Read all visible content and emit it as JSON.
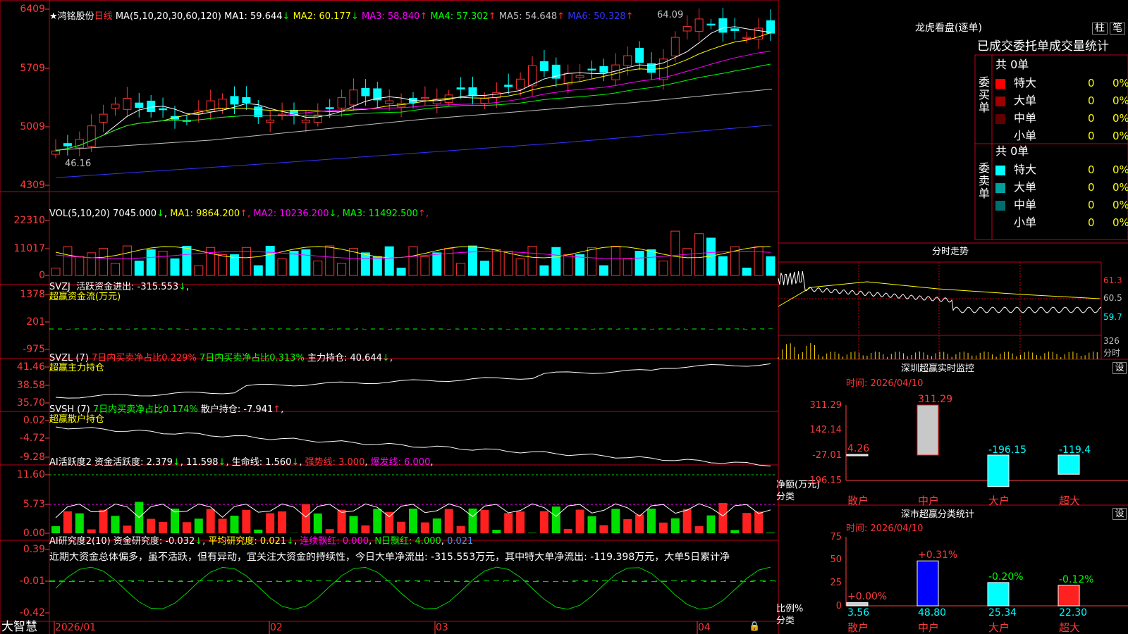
{
  "stock": {
    "name": "鸿铭股份",
    "period": "日线",
    "ma_label": "MA(5,10,20,30,60,120)",
    "ma": [
      {
        "label": "MA1: 59.644",
        "arrow": "↓",
        "color": "#ffffff"
      },
      {
        "label": "MA2: 60.177",
        "arrow": "↓",
        "color": "#ffff00"
      },
      {
        "label": "MA3: 58.840",
        "arrow": "↑",
        "color": "#ff00ff"
      },
      {
        "label": "MA4: 57.302",
        "arrow": "↑",
        "color": "#00ff00"
      },
      {
        "label": "MA5: 54.648",
        "arrow": "↑",
        "color": "#c0c0c0"
      },
      {
        "label": "MA6: 50.328",
        "arrow": "↑",
        "color": "#3333ff"
      }
    ],
    "high_label": "64.09",
    "low_label": "46.16"
  },
  "colors": {
    "up": "#ff3232",
    "down": "#00ffff",
    "grid": "#c0001a",
    "axis": "#ff3c3c"
  },
  "axes": {
    "price": [
      "6409",
      "5709",
      "5009",
      "4309"
    ],
    "vol": [
      "22310",
      "11017",
      "0"
    ],
    "svzj": [
      "1378",
      "201",
      "-975"
    ],
    "svzl": [
      "41.46",
      "38.58",
      "35.70"
    ],
    "svsh": [
      "0.02",
      "-4.72",
      "-9.28"
    ],
    "ai1": [
      "11.60",
      "5.73",
      "0.00"
    ],
    "ai2": [
      "0.39",
      "-0.01",
      "-0.42"
    ]
  },
  "vol": {
    "title": "VOL(5,10,20)",
    "v": "7045.000",
    "ma": [
      {
        "label": "MA1: 9864.200",
        "arrow": "↑",
        "color": "#ffff00"
      },
      {
        "label": "MA2: 10236.200",
        "arrow": "↓",
        "color": "#ff00ff"
      },
      {
        "label": "MA3: 11492.500",
        "arrow": "↑",
        "color": "#00ff00"
      }
    ]
  },
  "svzj": {
    "title": "SVZJ",
    "label": "活跃资金进出: -315.553",
    "arrow": "↓",
    "sub": "超赢资金流(万元)"
  },
  "svzl": {
    "title": "SVZL (7)",
    "a": "7日内买卖净占比0.229%",
    "b": "7日内买卖净占比0.313%",
    "c": "主力持仓: 40.644",
    "sub": "超赢主力持仓"
  },
  "svsh": {
    "title": "SVSH (7)",
    "a": "7日内买卖净占比0.174%",
    "c": "散户持仓: -7.941",
    "sub": "超赢散户持仓"
  },
  "ai1": {
    "title": "AI活跃度2",
    "a": "资金活跃度: 2.379",
    "b": "11.598",
    "c": "生命线: 1.560",
    "d": "强势线: 3.000",
    "e": "爆发线: 6.000"
  },
  "ai2": {
    "title": "AI研究度2(10)",
    "a": "资金研究度: -0.032",
    "b": "平均研究度: 0.021",
    "c": "连续飘红: 0.000",
    "d": "N日飘红: 4.000",
    "e": "0.021"
  },
  "commentary": "近期大资金总体偏多，虽不活跃，但有异动，宜关注大资金的持续性，今日大单净流出: -315.553万元，其中特大单净流出: -119.398万元，大单5日累计净",
  "bottom": {
    "brand": "大智慧",
    "dates": [
      "2026/01",
      "02",
      "03",
      "04"
    ]
  },
  "lhb": {
    "title": "龙虎看盘(逐单)",
    "btn1": "柱",
    "btn2": "笔",
    "subtitle": "已成交委托单成交量统计",
    "buy_label": "委买单",
    "sell_label": "委卖单",
    "count_buy": "共 0单",
    "count_sell": "共 0单",
    "buy_rows": [
      {
        "name": "特大",
        "v": "0",
        "p": "0%",
        "color": "#ff0000"
      },
      {
        "name": "大单",
        "v": "0",
        "p": "0%",
        "color": "#a00000"
      },
      {
        "name": "中单",
        "v": "0",
        "p": "0%",
        "color": "#600000"
      },
      {
        "name": "小单",
        "v": "0",
        "p": "0%",
        "color": ""
      }
    ],
    "sell_rows": [
      {
        "name": "特大",
        "v": "0",
        "p": "0%",
        "color": "#00ffff"
      },
      {
        "name": "大单",
        "v": "0",
        "p": "0%",
        "color": "#00a0a0"
      },
      {
        "name": "中单",
        "v": "0",
        "p": "0%",
        "color": "#006e6e"
      },
      {
        "name": "小单",
        "v": "0",
        "p": "0%",
        "color": ""
      }
    ]
  },
  "intraday": {
    "title": "分时走势",
    "p1": "61.3",
    "p2": "60.5",
    "p3": "59.7",
    "vol": "326",
    "vl": "分时"
  },
  "monitor": {
    "title": "深圳超赢实时监控",
    "btn": "设",
    "time": "时间: 2026/04/10",
    "ylabels": [
      "311.29",
      "142.14",
      "-27.01",
      "-196.15"
    ],
    "ylabel": "净额(万元)",
    "xl": "分类",
    "cats": [
      "散户",
      "中户",
      "大户",
      "超大"
    ],
    "vals": [
      4.26,
      311.29,
      -196.15,
      -119.4
    ],
    "labels": [
      "4.26",
      "311.29",
      "-196.15",
      "-119.4"
    ]
  },
  "stats": {
    "title": "深市超赢分类统计",
    "btn": "设",
    "time": "时间: 2026/04/10",
    "ylabels": [
      "75",
      "50",
      "25",
      "0"
    ],
    "ylabel": "比例%",
    "xl": "分类",
    "cats": [
      "散户",
      "中户",
      "大户",
      "超大"
    ],
    "vals": [
      3.56,
      48.8,
      25.34,
      22.3
    ],
    "vlabels": [
      "3.56",
      "48.80",
      "25.34",
      "22.30"
    ],
    "chg": [
      "+0.00%",
      "+0.31%",
      "-0.20%",
      "-0.12%"
    ]
  }
}
